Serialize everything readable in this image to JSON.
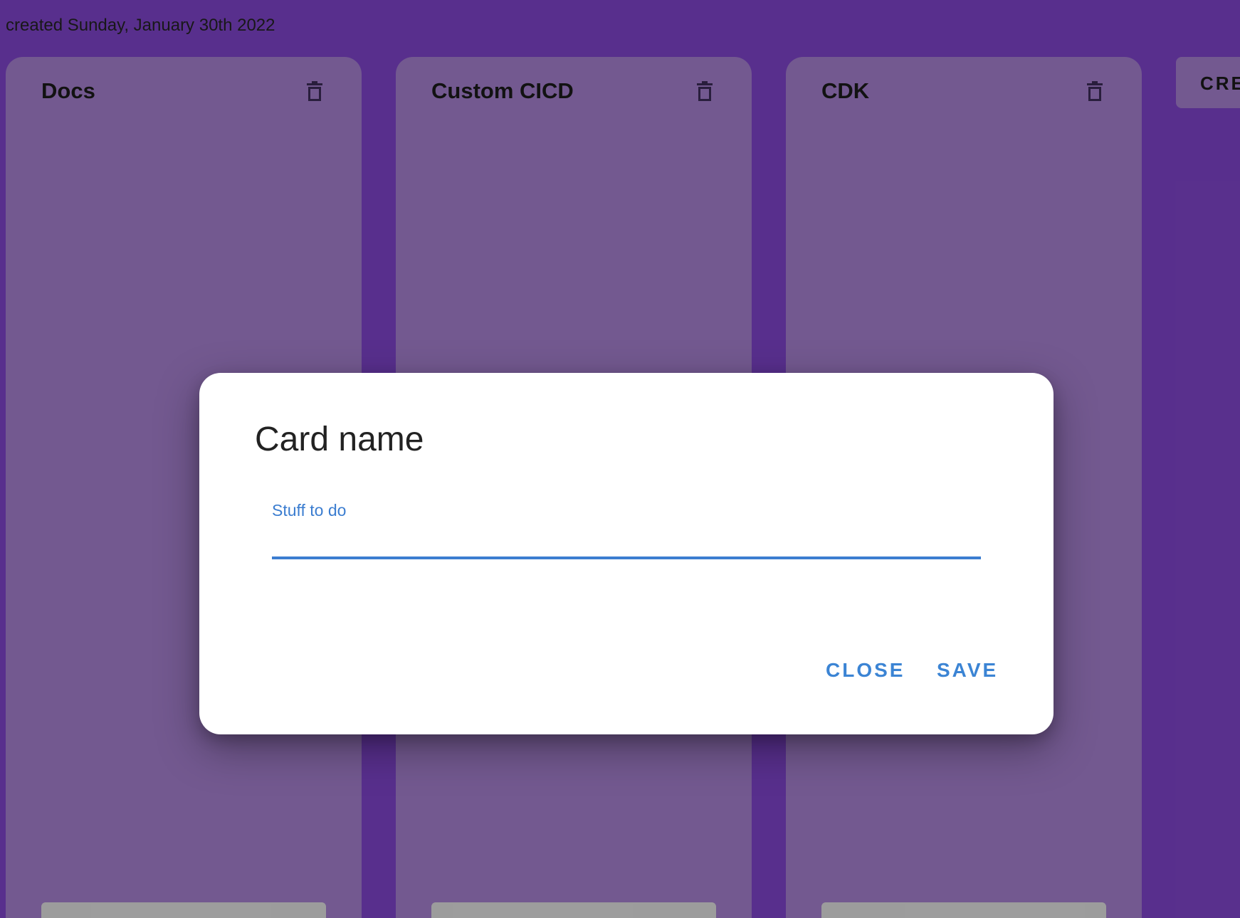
{
  "board": {
    "created_text": "created Sunday, January 30th 2022",
    "columns": [
      {
        "title": "Docs"
      },
      {
        "title": "Custom CICD"
      },
      {
        "title": "CDK"
      }
    ],
    "create_button_label": "CRE",
    "icons": {
      "column_delete": "trash-icon"
    }
  },
  "dialog": {
    "title": "Card name",
    "field_label": "Stuff to do",
    "field_value": "",
    "close_label": "CLOSE",
    "save_label": "SAVE"
  },
  "colors": {
    "background": "#7b42c4",
    "column": "#a07cc8",
    "accent": "#3b7dd0",
    "dialog": "#ffffff"
  }
}
